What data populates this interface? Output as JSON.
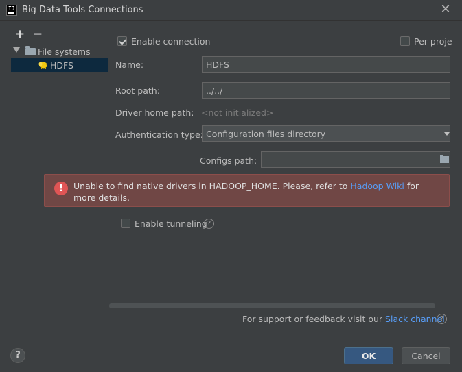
{
  "window": {
    "title": "Big Data Tools Connections",
    "app_icon_text": "IJ",
    "close_glyph": "✕"
  },
  "toolbar": {
    "add_glyph": "+",
    "remove_glyph": "−"
  },
  "tree": {
    "group_label": "File systems",
    "items": [
      {
        "label": "HDFS",
        "selected": true
      }
    ]
  },
  "form": {
    "enable_connection_label": "Enable connection",
    "enable_connection_checked": true,
    "per_project_label": "Per proje",
    "per_project_checked": false,
    "name_label": "Name:",
    "name_value": "HDFS",
    "root_path_label": "Root path:",
    "root_path_value": "../../",
    "driver_home_label": "Driver home path:",
    "driver_home_value": "<not initialized>",
    "auth_type_label": "Authentication type:",
    "auth_type_value": "Configuration files directory",
    "configs_path_label": "Configs path:",
    "configs_path_value": "",
    "enable_tunneling_label": "Enable tunneling",
    "enable_tunneling_checked": false
  },
  "error": {
    "icon_glyph": "!",
    "text_before": "Unable to find native drivers in HADOOP_HOME. Please, refer to ",
    "link_text": "Hadoop Wiki",
    "text_after": " for more details."
  },
  "footer": {
    "support_text": "For support or feedback visit our ",
    "support_link": "Slack channel",
    "help_glyph": "?",
    "ok_label": "OK",
    "cancel_label": "Cancel"
  },
  "colors": {
    "background": "#3c3f41",
    "selection": "#0d293e",
    "error_bg": "#704745",
    "link": "#589df6",
    "ok_button": "#365880"
  }
}
